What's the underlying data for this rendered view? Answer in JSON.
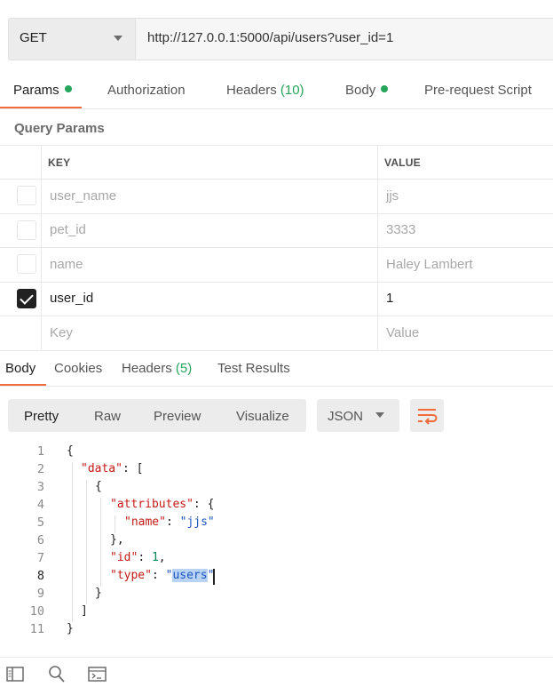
{
  "request": {
    "method": "GET",
    "url": "http://127.0.0.1:5000/api/users?user_id=1"
  },
  "request_tabs": [
    {
      "label": "Params",
      "dot": true,
      "active": true
    },
    {
      "label": "Authorization"
    },
    {
      "label": "Headers",
      "count": "(10)"
    },
    {
      "label": "Body",
      "dot": true
    },
    {
      "label": "Pre-request Script"
    }
  ],
  "query_params": {
    "title": "Query Params",
    "columns": {
      "key": "KEY",
      "value": "VALUE"
    },
    "rows": [
      {
        "key": "user_name",
        "value": "jjs",
        "checked": false
      },
      {
        "key": "pet_id",
        "value": "3333",
        "checked": false
      },
      {
        "key": "name",
        "value": "Haley Lambert",
        "checked": false
      },
      {
        "key": "user_id",
        "value": "1",
        "checked": true
      }
    ],
    "placeholder": {
      "key": "Key",
      "value": "Value"
    }
  },
  "response_tabs": [
    {
      "label": "Body",
      "active": true
    },
    {
      "label": "Cookies"
    },
    {
      "label": "Headers",
      "count": "(5)"
    },
    {
      "label": "Test Results"
    }
  ],
  "view_modes": [
    "Pretty",
    "Raw",
    "Preview",
    "Visualize"
  ],
  "format": "JSON",
  "code": {
    "line_numbers": [
      "1",
      "2",
      "3",
      "4",
      "5",
      "6",
      "7",
      "8",
      "9",
      "10",
      "11"
    ],
    "lines": [
      "{",
      "\"data\": [",
      "{",
      "\"attributes\": {",
      "\"name\": \"jjs\"",
      "},",
      "\"id\": 1,",
      "\"type\": \"users\"",
      "}",
      "]",
      "}"
    ],
    "selected_text": "users"
  },
  "footer_icons": [
    "sidebar-icon",
    "search-icon",
    "console-icon"
  ],
  "colors": {
    "accent": "#f26b3a",
    "status_dot": "#26a55a",
    "json_key": "#c41a16",
    "json_string": "#1c54c2",
    "json_number": "#098658"
  }
}
